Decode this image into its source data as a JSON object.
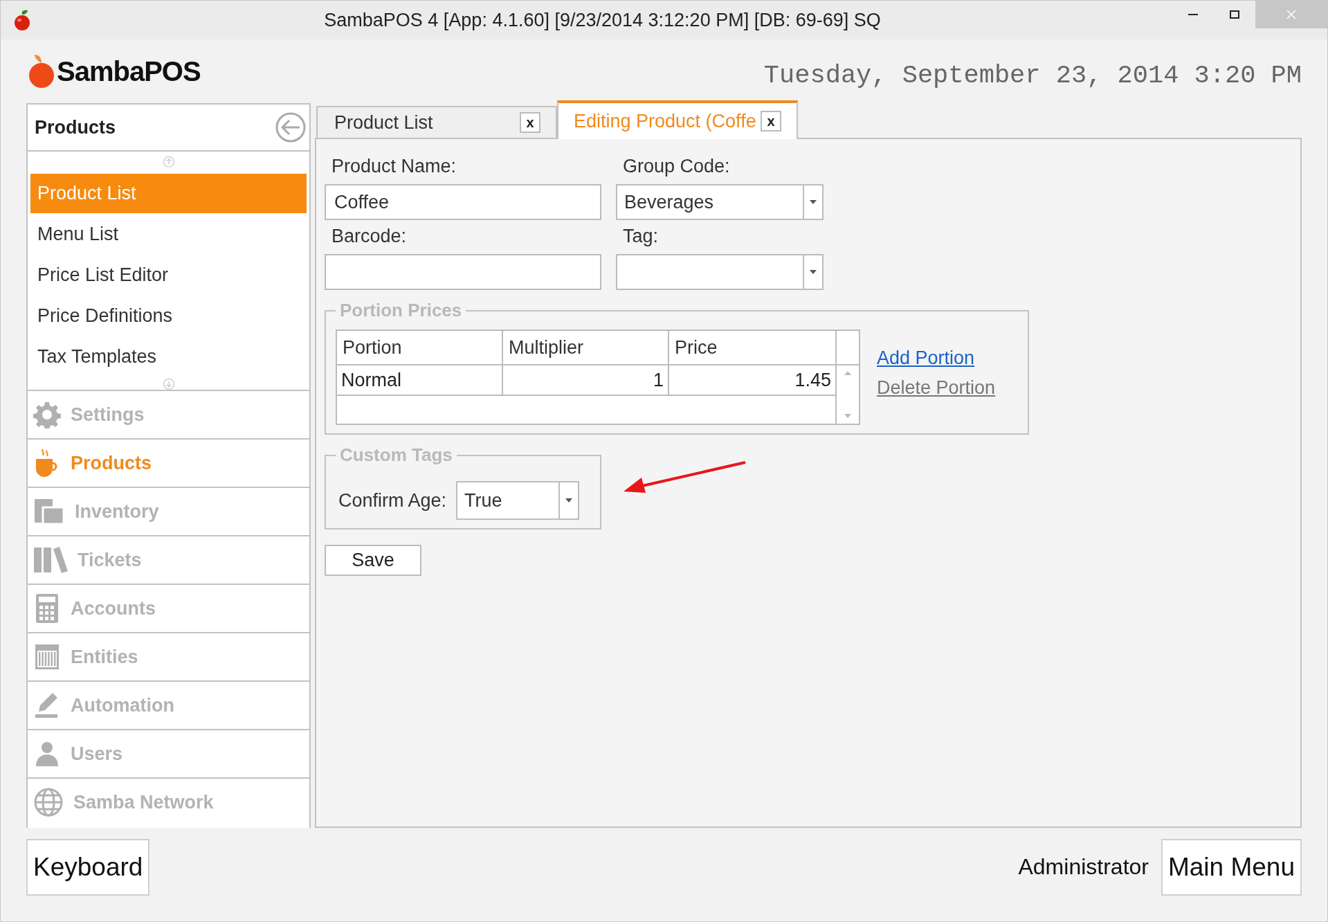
{
  "title_bar": {
    "title": "SambaPOS 4 [App: 4.1.60] [9/23/2014 3:12:20 PM] [DB: 69-69] SQ"
  },
  "header": {
    "logo": "SambaPOS",
    "date": "Tuesday, September 23, 2014 3:20 PM"
  },
  "sidebar": {
    "title": "Products",
    "items": [
      {
        "label": "Product List",
        "selected": true
      },
      {
        "label": "Menu List",
        "selected": false
      },
      {
        "label": "Price List Editor",
        "selected": false
      },
      {
        "label": "Price Definitions",
        "selected": false
      },
      {
        "label": "Tax Templates",
        "selected": false
      }
    ],
    "nav": [
      {
        "label": "Settings",
        "kind": "gear",
        "selected": false
      },
      {
        "label": "Products",
        "kind": "cup",
        "selected": true
      },
      {
        "label": "Inventory",
        "kind": "boxes",
        "selected": false
      },
      {
        "label": "Tickets",
        "kind": "books",
        "selected": false
      },
      {
        "label": "Accounts",
        "kind": "calculator",
        "selected": false
      },
      {
        "label": "Entities",
        "kind": "grid",
        "selected": false
      },
      {
        "label": "Automation",
        "kind": "pen",
        "selected": false
      },
      {
        "label": "Users",
        "kind": "user",
        "selected": false
      },
      {
        "label": "Samba Network",
        "kind": "globe",
        "selected": false
      }
    ]
  },
  "tabs": [
    {
      "label": "Product List",
      "close": "x",
      "selected": false
    },
    {
      "label": "Editing Product (Coffe",
      "close": "x",
      "selected": true
    }
  ],
  "form": {
    "product_name": {
      "label": "Product Name:",
      "value": "Coffee"
    },
    "group_code": {
      "label": "Group Code:",
      "value": "Beverages"
    },
    "barcode": {
      "label": "Barcode:"
    },
    "tag": {
      "label": "Tag:"
    }
  },
  "portion_prices": {
    "legend": "Portion Prices",
    "columns": [
      "Portion",
      "Multiplier",
      "Price"
    ],
    "rows": [
      [
        "Normal",
        "1",
        "1.45"
      ]
    ],
    "links": [
      {
        "label": "Add Portion",
        "kind": "active"
      },
      {
        "label": "Delete Portion",
        "kind": "muted"
      }
    ]
  },
  "custom_tags": {
    "legend": "Custom Tags",
    "label": "Confirm Age:",
    "value": "True"
  },
  "save_button": "Save",
  "footer": {
    "keyboard": "Keyboard",
    "user": "Administrator",
    "main_menu": "Main Menu"
  }
}
